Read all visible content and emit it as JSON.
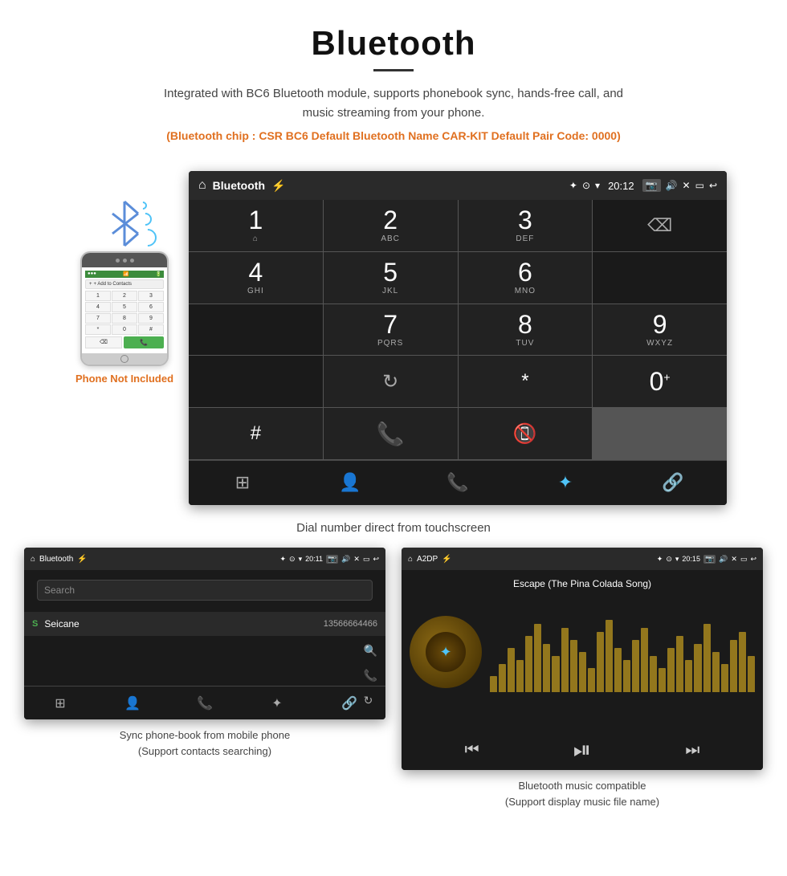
{
  "header": {
    "title": "Bluetooth",
    "description": "Integrated with BC6 Bluetooth module, supports phonebook sync, hands-free call, and music streaming from your phone.",
    "specs": "(Bluetooth chip : CSR BC6    Default Bluetooth Name CAR-KIT    Default Pair Code: 0000)"
  },
  "main_screen": {
    "status_bar": {
      "app_name": "Bluetooth",
      "time": "20:12",
      "icons": [
        "home",
        "usb",
        "bluetooth",
        "location",
        "wifi",
        "camera",
        "volume",
        "close",
        "window",
        "back"
      ]
    },
    "dialpad": {
      "keys": [
        {
          "num": "1",
          "letters": ""
        },
        {
          "num": "2",
          "letters": "ABC"
        },
        {
          "num": "3",
          "letters": "DEF"
        },
        {
          "num": "",
          "letters": "",
          "type": "empty"
        },
        {
          "num": "",
          "letters": "",
          "type": "backspace"
        },
        {
          "num": "4",
          "letters": "GHI"
        },
        {
          "num": "5",
          "letters": "JKL"
        },
        {
          "num": "6",
          "letters": "MNO"
        },
        {
          "num": "",
          "letters": "",
          "type": "empty"
        },
        {
          "num": "",
          "letters": "",
          "type": "empty"
        },
        {
          "num": "7",
          "letters": "PQRS"
        },
        {
          "num": "8",
          "letters": "TUV"
        },
        {
          "num": "9",
          "letters": "WXYZ"
        },
        {
          "num": "",
          "letters": "",
          "type": "empty"
        },
        {
          "num": "",
          "letters": "",
          "type": "reload"
        },
        {
          "num": "*",
          "letters": ""
        },
        {
          "num": "0",
          "letters": "+",
          "zero": true
        },
        {
          "num": "#",
          "letters": ""
        },
        {
          "num": "",
          "letters": "",
          "type": "call-green"
        },
        {
          "num": "",
          "letters": "",
          "type": "call-red"
        }
      ],
      "bottom_nav": [
        "grid",
        "person",
        "phone",
        "bluetooth",
        "link"
      ]
    },
    "caption": "Dial number direct from touchscreen"
  },
  "phone_mockup": {
    "label": "Phone Not Included",
    "contact_btn": "+ Add to Contacts",
    "keys": [
      "1",
      "2",
      "3",
      "4",
      "5",
      "6",
      "7",
      "8",
      "9",
      "*",
      "0",
      "#"
    ]
  },
  "phonebook_screen": {
    "status_bar": {
      "app_name": "Bluetooth",
      "time": "20:11"
    },
    "search_placeholder": "Search",
    "entries": [
      {
        "letter": "S",
        "name": "Seicane",
        "number": "13566664466"
      }
    ],
    "caption_line1": "Sync phone-book from mobile phone",
    "caption_line2": "(Support contacts searching)"
  },
  "music_screen": {
    "status_bar": {
      "app_name": "A2DP",
      "time": "20:15"
    },
    "song_title": "Escape (The Pina Colada Song)",
    "visualizer_bars": [
      20,
      35,
      55,
      40,
      70,
      85,
      60,
      45,
      80,
      65,
      50,
      30,
      75,
      90,
      55,
      40,
      65,
      80,
      45,
      30,
      55,
      70,
      40,
      60,
      85,
      50,
      35,
      65,
      75,
      45
    ],
    "controls": [
      "prev",
      "play-pause",
      "next"
    ],
    "caption_line1": "Bluetooth music compatible",
    "caption_line2": "(Support display music file name)"
  }
}
